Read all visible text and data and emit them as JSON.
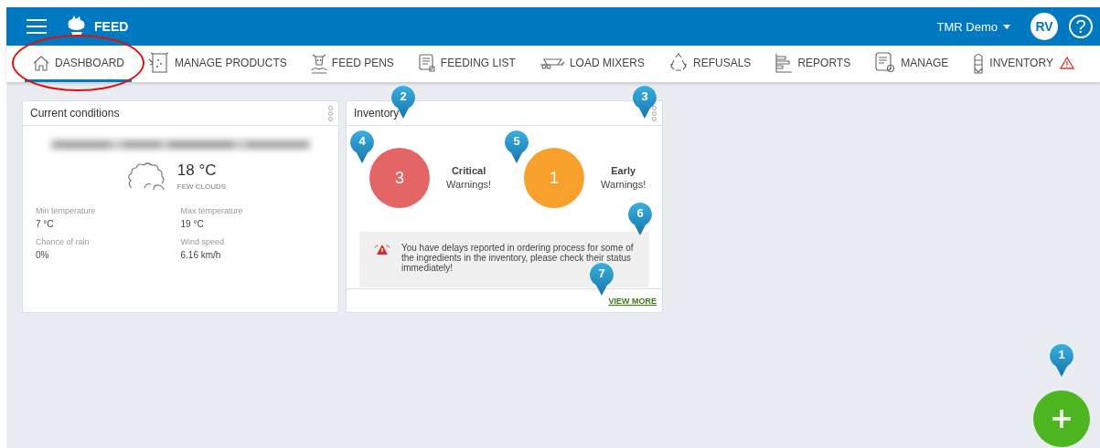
{
  "header": {
    "app_name": "FEED",
    "user": "TMR Demo",
    "avatar": "RV",
    "help": "?"
  },
  "tabs": [
    {
      "label": "DASHBOARD",
      "kind": "home",
      "selected": true,
      "circled": true
    },
    {
      "label": "MANAGE PRODUCTS",
      "kind": "bag",
      "selected": false
    },
    {
      "label": "FEED PENS",
      "kind": "cow",
      "selected": false
    },
    {
      "label": "FEEDING LIST",
      "kind": "list",
      "selected": false
    },
    {
      "label": "LOAD MIXERS",
      "kind": "mixer",
      "selected": false
    },
    {
      "label": "REFUSALS",
      "kind": "recycle",
      "selected": false
    },
    {
      "label": "REPORTS",
      "kind": "reports",
      "selected": false
    },
    {
      "label": "MANAGE",
      "kind": "manage",
      "selected": false
    },
    {
      "label": "INVENTORY",
      "kind": "silo",
      "selected": false,
      "warning": true
    }
  ],
  "weather": {
    "title": "Current conditions",
    "temperature": "18 °C",
    "description": "FEW CLOUDS",
    "stats": [
      {
        "label": "Min temperature",
        "value": "7 °C"
      },
      {
        "label": "Max temperature",
        "value": "19 °C"
      },
      {
        "label": "Chance of rain",
        "value": "0%"
      },
      {
        "label": "Wind speed",
        "value": "6.16 km/h"
      }
    ]
  },
  "inventory": {
    "title": "Inventory",
    "title_pin": "2",
    "menu_pin": "3",
    "warnings": [
      {
        "count": "3",
        "label": "Critical",
        "sublabel": "Warnings!",
        "color": "#e46566",
        "pin": "4"
      },
      {
        "count": "1",
        "label": "Early",
        "sublabel": "Warnings!",
        "color": "#f7a02c",
        "pin": "5"
      }
    ],
    "alert": {
      "text": "You have delays reported in ordering process for some of the ingredients in the inventory, please check their status immediately!",
      "pin": "6"
    },
    "link": {
      "label": "VIEW MORE",
      "pin": "7"
    }
  },
  "fab": {
    "pin": "1"
  }
}
